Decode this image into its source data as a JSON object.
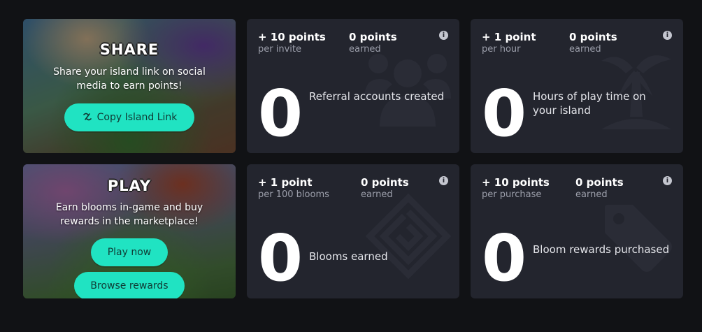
{
  "share": {
    "title": "SHARE",
    "description": "Share your island link on social media to earn points!",
    "button_label": "Copy Island Link"
  },
  "play": {
    "title": "PLAY",
    "description": "Earn blooms in-game and buy rewards in the marketplace!",
    "play_button_label": "Play now",
    "browse_button_label": "Browse rewards"
  },
  "cards": [
    {
      "rate_value": "+ 10 points",
      "rate_unit": "per invite",
      "earned_value": "0 points",
      "earned_label": "earned",
      "big_value": "0",
      "label": "Referral accounts created",
      "icon": "users-icon"
    },
    {
      "rate_value": "+ 1 point",
      "rate_unit": "per hour",
      "earned_value": "0 points",
      "earned_label": "earned",
      "big_value": "0",
      "label": "Hours of play time on your island",
      "icon": "palm-tree-icon"
    },
    {
      "rate_value": "+ 1 point",
      "rate_unit": "per 100 blooms",
      "earned_value": "0 points",
      "earned_label": "earned",
      "big_value": "0",
      "label": "Blooms earned",
      "icon": "spiral-diamond-icon"
    },
    {
      "rate_value": "+ 10 points",
      "rate_unit": "per purchase",
      "earned_value": "0 points",
      "earned_label": "earned",
      "big_value": "0",
      "label": "Bloom rewards purchased",
      "icon": "price-tag-icon"
    }
  ],
  "colors": {
    "page_bg": "#111215",
    "card_bg": "#23252e",
    "accent": "#20e3c2",
    "muted_text": "#9c9fab"
  }
}
